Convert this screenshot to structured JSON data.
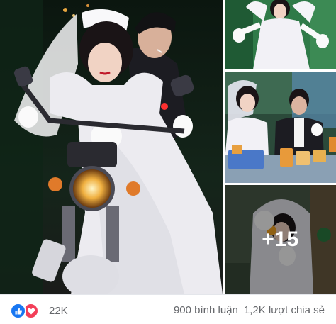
{
  "photos": {
    "more_label": "+15"
  },
  "footer": {
    "reaction_count": "22K",
    "comments": "900 bình luận",
    "shares": "1,2K lượt chia sẻ"
  },
  "colors": {
    "like": "#1877f2",
    "love": "#f33e58",
    "meta_text": "#65676b"
  }
}
